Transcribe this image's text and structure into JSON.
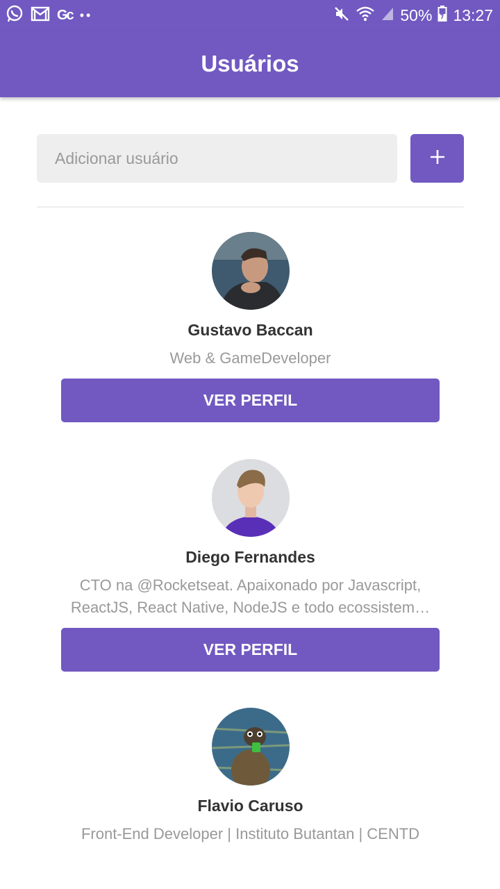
{
  "status_bar": {
    "app_icons": [
      "whatsapp-icon",
      "gmail-icon",
      "app-gc-icon"
    ],
    "gc_text": "Gc",
    "dots": "••",
    "battery_percent": "50%",
    "time": "13:27"
  },
  "header": {
    "title": "Usuários"
  },
  "search": {
    "placeholder": "Adicionar usuário",
    "add_label": "+"
  },
  "users": [
    {
      "name": "Gustavo Baccan",
      "bio": "Web & GameDeveloper",
      "button": "VER PERFIL"
    },
    {
      "name": "Diego Fernandes",
      "bio": "CTO na @Rocketseat. Apaixonado por Javascript, ReactJS, React Native, NodeJS e todo ecossistem…",
      "button": "VER PERFIL"
    },
    {
      "name": "Flavio Caruso",
      "bio": "Front-End Developer | Instituto Butantan | CENTD"
    }
  ],
  "colors": {
    "primary": "#7159c1",
    "name_text": "#333333",
    "bio_text": "#999999",
    "input_bg": "#eeeeee"
  }
}
